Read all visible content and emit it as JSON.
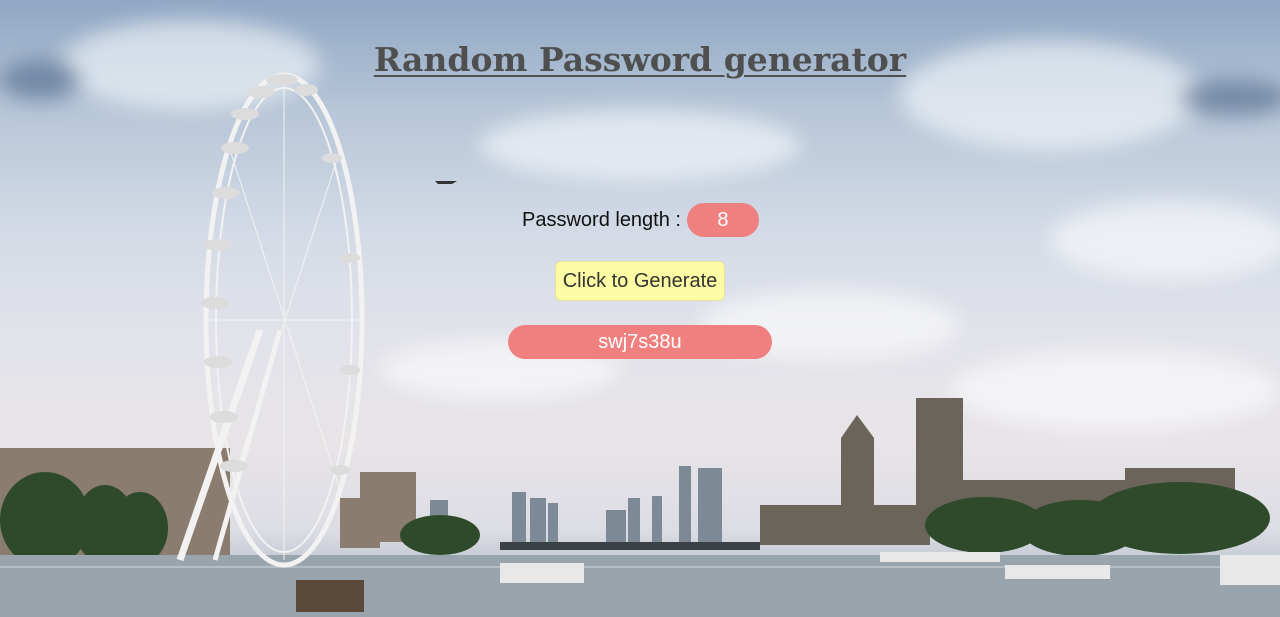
{
  "page": {
    "title": "Random Password generator"
  },
  "form": {
    "length_label": "Password length :",
    "length_value": "8",
    "generate_label": "Click to Generate",
    "output_value": "swj7s38u"
  },
  "background": {
    "scene": "london-eye-thames-skyline"
  },
  "colors": {
    "pill": "#f08080",
    "button": "#fdfca4",
    "title": "#4f4f4f"
  }
}
